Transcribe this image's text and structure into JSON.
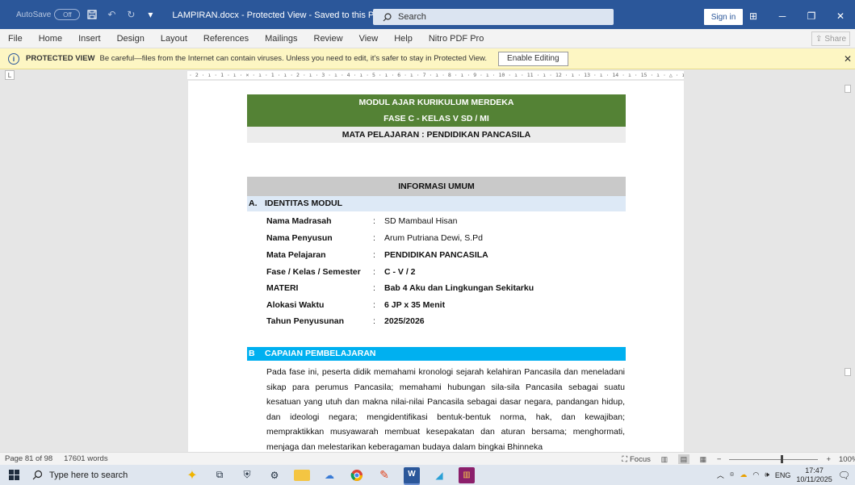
{
  "titlebar": {
    "autosave_label": "AutoSave",
    "autosave_state": "Off",
    "doc_title": "LAMPIRAN.docx  -  Protected View  -  Saved to this PC  ▾",
    "search_placeholder": "Search",
    "signin_label": "Sign in"
  },
  "menu": {
    "items": [
      "File",
      "Home",
      "Insert",
      "Design",
      "Layout",
      "References",
      "Mailings",
      "Review",
      "View",
      "Help",
      "Nitro PDF Pro"
    ],
    "share_label": "Share"
  },
  "protected_view": {
    "title": "PROTECTED VIEW",
    "message": "Be careful—files from the Internet can contain viruses. Unless you need to edit, it's safer to stay in Protected View.",
    "button_label": "Enable Editing"
  },
  "ruler": {
    "text": "· 2 · ı · 1 · ı · ⨯ · ı · 1 · ı · 2 · ı · 3 · ı · 4 · ı · 5 · ı · 6 · ı · 7 · ı · 8 · ı · 9 · ı · 10 · ı · 11 · ı · 12 · ı · 13 · ı · 14 · ı · 15 · ı · △ · ı · 17 · ı · 18 ·"
  },
  "document": {
    "header_line1": "MODUL AJAR KURIKULUM MERDEKA",
    "header_line2": "FASE C - KELAS V SD / MI",
    "header_line3": "MATA PELAJARAN : PENDIDIKAN PANCASILA",
    "info_umum": "INFORMASI UMUM",
    "section_a_letter": "A.",
    "section_a_title": "IDENTITAS MODUL",
    "identity": [
      {
        "key": "Nama Madrasah",
        "value": "SD Mambaul Hisan",
        "bold": false
      },
      {
        "key": "Nama Penyusun",
        "value": "Arum Putriana Dewi, S.Pd",
        "bold": false
      },
      {
        "key": "Mata Pelajaran",
        "value": "PENDIDIKAN PANCASILA",
        "bold": true
      },
      {
        "key": "Fase / Kelas / Semester",
        "value": "C - V / 2",
        "bold": true
      },
      {
        "key": "MATERI",
        "value": "Bab 4 Aku dan Lingkungan Sekitarku",
        "bold": true
      },
      {
        "key": "Alokasi Waktu",
        "value": "6 JP x 35 Menit",
        "bold": true
      },
      {
        "key": "Tahun Penyusunan",
        "value": "2025/2026",
        "bold": true
      }
    ],
    "section_b_letter": "B",
    "section_b_title": "CAPAIAN PEMBELAJARAN",
    "paragraph": "Pada fase ini, peserta didik memahami kronologi sejarah kelahiran Pancasila dan meneladani sikap para perumus Pancasila; memahami hubungan sila-sila Pancasila sebagai suatu kesatuan yang utuh dan makna nilai-nilai Pancasila sebagai dasar negara, pandangan hidup, dan ideologi negara; mengidentifikasi bentuk-bentuk norma, hak, dan kewajiban; mempraktikkan musyawarah membuat kesepakatan dan aturan bersama; menghormati, menjaga dan melestarikan keberagaman budaya dalam bingkai Bhinneka"
  },
  "status": {
    "page": "Page 81 of 98",
    "words": "17601 words",
    "focus_label": "Focus",
    "zoom": "100%"
  },
  "taskbar": {
    "search_placeholder": "Type here to search",
    "lang": "ENG",
    "time": "17:47",
    "date": "10/11/2025"
  },
  "colors": {
    "title_blue": "#2b579a",
    "header_green": "#548235",
    "section_b_cyan": "#00b0f0",
    "protected_yellow": "#fdf6c3"
  }
}
